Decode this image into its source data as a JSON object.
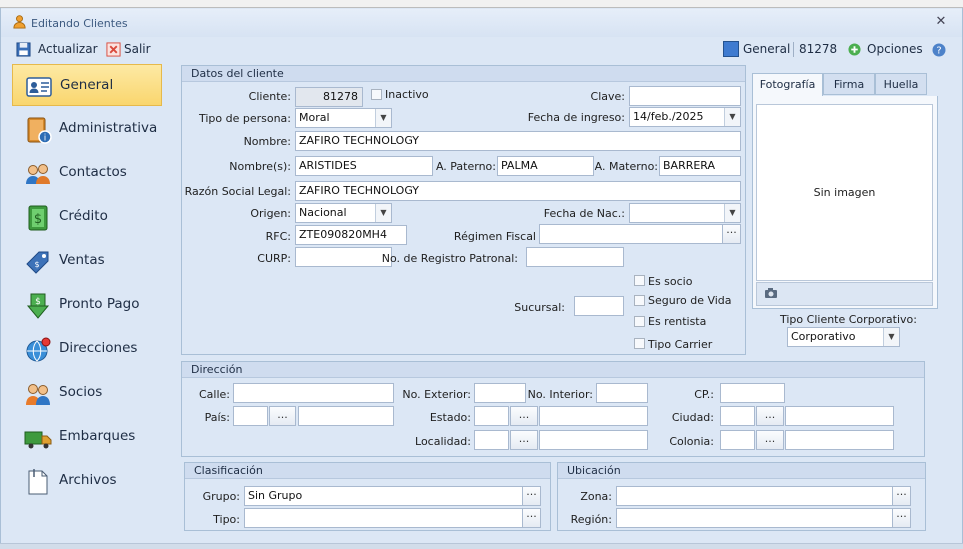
{
  "window": {
    "title": "Editando Clientes"
  },
  "toolbar": {
    "actualizar": "Actualizar",
    "salir": "Salir",
    "section": "General",
    "record": "81278",
    "opciones": "Opciones"
  },
  "sidebar": {
    "items": [
      {
        "label": "General",
        "icon": "id-card-icon"
      },
      {
        "label": "Administrativa",
        "icon": "book-info-icon"
      },
      {
        "label": "Contactos",
        "icon": "people-icon"
      },
      {
        "label": "Crédito",
        "icon": "money-icon"
      },
      {
        "label": "Ventas",
        "icon": "price-tag-icon"
      },
      {
        "label": "Pronto Pago",
        "icon": "money-down-icon"
      },
      {
        "label": "Direcciones",
        "icon": "globe-pin-icon"
      },
      {
        "label": "Socios",
        "icon": "partners-icon"
      },
      {
        "label": "Embarques",
        "icon": "truck-icon"
      },
      {
        "label": "Archivos",
        "icon": "document-icon"
      }
    ],
    "selected": "General"
  },
  "datos": {
    "header": "Datos del cliente",
    "cliente_label": "Cliente:",
    "cliente_value": "81278",
    "inactivo": "Inactivo",
    "clave_label": "Clave:",
    "clave_value": "",
    "tipo_persona_label": "Tipo de persona:",
    "tipo_persona_value": "Moral",
    "fecha_ingreso_label": "Fecha de ingreso:",
    "fecha_ingreso_value": "14/feb./2025",
    "nombre_label": "Nombre:",
    "nombre_value": "ZAFIRO TECHNOLOGY",
    "nombres_label": "Nombre(s):",
    "nombres_value": "ARISTIDES",
    "apaterno_label": "A. Paterno:",
    "apaterno_value": "PALMA",
    "amaterno_label": "A. Materno:",
    "amaterno_value": "BARRERA",
    "razon_label": "Razón Social Legal:",
    "razon_value": "ZAFIRO TECHNOLOGY",
    "origen_label": "Origen:",
    "origen_value": "Nacional",
    "fecha_nac_label": "Fecha de Nac.:",
    "fecha_nac_value": "",
    "rfc_label": "RFC:",
    "rfc_value": "ZTE090820MH4",
    "regimen_label": "Régimen Fiscal",
    "regimen_value": "",
    "curp_label": "CURP:",
    "curp_value": "",
    "registro_label": "No. de Registro Patronal:",
    "registro_value": "",
    "sucursal_label": "Sucursal:",
    "sucursal_value": "",
    "es_socio": "Es socio",
    "seguro_vida": "Seguro de Vida",
    "es_rentista": "Es rentista",
    "tipo_carrier": "Tipo Carrier"
  },
  "foto": {
    "tabs": [
      "Fotografía",
      "Firma",
      "Huella"
    ],
    "sin_imagen": "Sin imagen",
    "tipo_corp_label": "Tipo Cliente Corporativo:",
    "tipo_corp_value": "Corporativo"
  },
  "direccion": {
    "header": "Dirección",
    "calle": "Calle:",
    "no_exterior": "No. Exterior:",
    "no_interior": "No. Interior:",
    "cp": "CP.:",
    "pais": "País:",
    "estado": "Estado:",
    "ciudad": "Ciudad:",
    "localidad": "Localidad:",
    "colonia": "Colonia:"
  },
  "clasificacion": {
    "header": "Clasificación",
    "grupo_label": "Grupo:",
    "grupo_value": "Sin Grupo",
    "tipo_label": "Tipo:"
  },
  "ubicacion": {
    "header": "Ubicación",
    "zona_label": "Zona:",
    "region_label": "Región:"
  },
  "colors": {
    "accent": "#f9d66e",
    "window_bg": "#dce7f5",
    "border": "#a9bfd6"
  }
}
